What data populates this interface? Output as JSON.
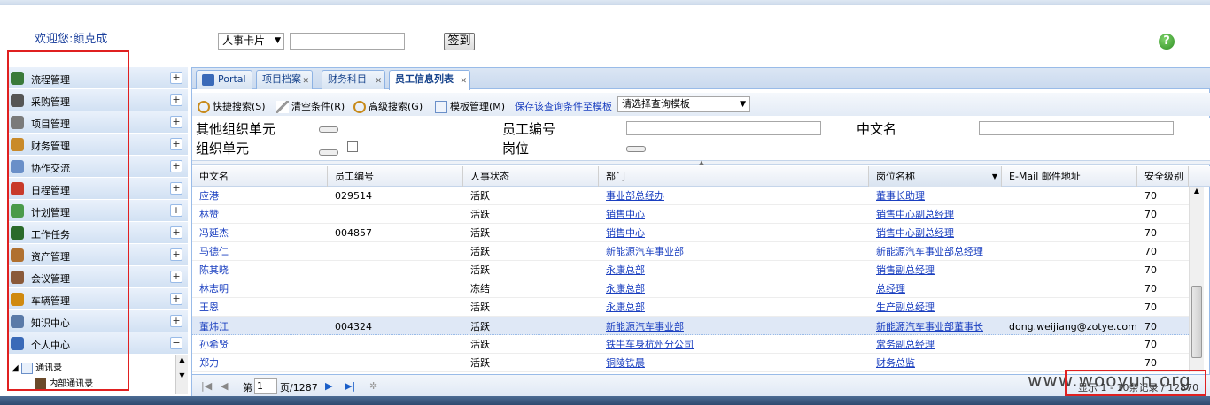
{
  "header": {
    "welcome": "欢迎您:颜克成",
    "card_select": "人事卡片",
    "sign_button": "签到"
  },
  "sidebar": {
    "items": [
      {
        "label": "流程管理",
        "icon": "workflow-icon",
        "color": "#3a7a3a",
        "toggle": "+"
      },
      {
        "label": "采购管理",
        "icon": "purchase-icon",
        "color": "#555555",
        "toggle": "+"
      },
      {
        "label": "项目管理",
        "icon": "project-icon",
        "color": "#7a7a7a",
        "toggle": "+"
      },
      {
        "label": "财务管理",
        "icon": "finance-icon",
        "color": "#c98a2a",
        "toggle": "+"
      },
      {
        "label": "协作交流",
        "icon": "chat-icon",
        "color": "#6a8fc8",
        "toggle": "+"
      },
      {
        "label": "日程管理",
        "icon": "calendar-icon",
        "color": "#c83a2a",
        "toggle": "+"
      },
      {
        "label": "计划管理",
        "icon": "plan-icon",
        "color": "#4a9a4a",
        "toggle": "+"
      },
      {
        "label": "工作任务",
        "icon": "task-icon",
        "color": "#2a6a2a",
        "toggle": "+"
      },
      {
        "label": "资产管理",
        "icon": "asset-icon",
        "color": "#b07030",
        "toggle": "+"
      },
      {
        "label": "会议管理",
        "icon": "meeting-icon",
        "color": "#8a5a3a",
        "toggle": "+"
      },
      {
        "label": "车辆管理",
        "icon": "vehicle-icon",
        "color": "#d08a10",
        "toggle": "+"
      },
      {
        "label": "知识中心",
        "icon": "knowledge-icon",
        "color": "#5a7aa8",
        "toggle": "+"
      },
      {
        "label": "个人中心",
        "icon": "person-icon",
        "color": "#3a6ab8",
        "toggle": "−"
      }
    ],
    "tree": {
      "root": "通讯录",
      "child": "内部通讯录"
    }
  },
  "tabs": [
    {
      "label": "Portal"
    },
    {
      "label": "项目档案"
    },
    {
      "label": "财务科目"
    },
    {
      "label": "员工信息列表"
    }
  ],
  "toolbar": {
    "quick_search": "快捷搜索(S)",
    "clear": "清空条件(R)",
    "advanced": "高级搜索(G)",
    "template_mgmt": "模板管理(M)",
    "save_template": "保存该查询条件至模板",
    "template_placeholder": "请选择查询模板"
  },
  "form": {
    "other_org": "其他组织单元",
    "emp_no": "员工编号",
    "cn_name": "中文名",
    "org_unit": "组织单元",
    "position": "岗位"
  },
  "grid": {
    "columns": [
      "中文名",
      "员工编号",
      "人事状态",
      "部门",
      "岗位名称",
      "E-Mail 邮件地址",
      "安全级别"
    ],
    "rows": [
      {
        "name": "应港",
        "no": "029514",
        "status": "活跃",
        "dept": "事业部总经办",
        "post": "董事长助理",
        "email": "",
        "level": "70"
      },
      {
        "name": "林赞",
        "no": "",
        "status": "活跃",
        "dept": "销售中心",
        "post": "销售中心副总经理",
        "email": "",
        "level": "70"
      },
      {
        "name": "冯延杰",
        "no": "004857",
        "status": "活跃",
        "dept": "销售中心",
        "post": "销售中心副总经理",
        "email": "",
        "level": "70"
      },
      {
        "name": "马德仁",
        "no": "",
        "status": "活跃",
        "dept": "新能源汽车事业部",
        "post": "新能源汽车事业部总经理",
        "email": "",
        "level": "70"
      },
      {
        "name": "陈其晓",
        "no": "",
        "status": "活跃",
        "dept": "永康总部",
        "post": "销售副总经理",
        "email": "",
        "level": "70"
      },
      {
        "name": "林志明",
        "no": "",
        "status": "冻结",
        "dept": "永康总部",
        "post": "总经理",
        "email": "",
        "level": "70"
      },
      {
        "name": "王恩",
        "no": "",
        "status": "活跃",
        "dept": "永康总部",
        "post": "生产副总经理",
        "email": "",
        "level": "70"
      },
      {
        "name": "董炜江",
        "no": "004324",
        "status": "活跃",
        "dept": "新能源汽车事业部",
        "post": "新能源汽车事业部董事长",
        "email": "dong.weijiang@zotye.com",
        "level": "70"
      },
      {
        "name": "孙希贤",
        "no": "",
        "status": "活跃",
        "dept": "铁牛车身杭州分公司",
        "post": "常务副总经理",
        "email": "",
        "level": "70"
      },
      {
        "name": "郑力",
        "no": "",
        "status": "活跃",
        "dept": "铜陵铁晨",
        "post": "财务总监",
        "email": "",
        "level": "70"
      }
    ]
  },
  "pager": {
    "page_prefix": "第",
    "page_value": "1",
    "page_suffix": "页/1287",
    "summary": "显示 1 - 10条记录 / 12870"
  },
  "watermark": "www.wooyun.org",
  "colors": {
    "accent": "#15428b",
    "link": "#1a3fc0",
    "highlight_box": "#e02020"
  }
}
